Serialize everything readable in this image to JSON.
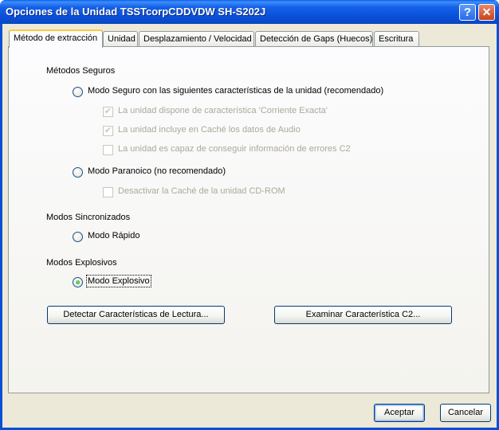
{
  "window": {
    "title": "Opciones de la Unidad TSSTcorpCDDVDW SH-S202J"
  },
  "titlebar_buttons": {
    "help": "?",
    "close": "✕"
  },
  "tabs": [
    {
      "label": "Método de extracción",
      "active": true
    },
    {
      "label": "Unidad"
    },
    {
      "label": "Desplazamiento / Velocidad"
    },
    {
      "label": "Detección de Gaps (Huecos)"
    },
    {
      "label": "Escritura"
    }
  ],
  "groups": {
    "safe": {
      "title": "Métodos Seguros",
      "secure_mode": {
        "label": "Modo Seguro con las siguientes características de la unidad (recomendado)",
        "selected": false
      },
      "checks": [
        {
          "label": "La unidad dispone de característica 'Corriente Exacta'",
          "checked": true,
          "mark": "✔"
        },
        {
          "label": "La unidad incluye en Caché los datos de Audio",
          "checked": true,
          "mark": "✔"
        },
        {
          "label": "La unidad es capaz de conseguir información de errores C2",
          "checked": false,
          "mark": ""
        }
      ],
      "paranoid_mode": {
        "label": "Modo Paranoico (no recomendado)",
        "selected": false
      },
      "paranoid_check": {
        "label": "Desactivar la Caché de la unidad CD-ROM",
        "checked": false,
        "mark": ""
      }
    },
    "sync": {
      "title": "Modos Sincronizados",
      "fast_mode": {
        "label": "Modo Rápido",
        "selected": false
      }
    },
    "burst": {
      "title": "Modos Explosivos",
      "burst_mode": {
        "label": "Modo Explosivo",
        "selected": true
      }
    }
  },
  "panel_buttons": {
    "detect": "Detectar Características de Lectura...",
    "c2": "Examinar Característica C2..."
  },
  "dialog_buttons": {
    "accept": "Aceptar",
    "cancel": "Cancelar"
  }
}
